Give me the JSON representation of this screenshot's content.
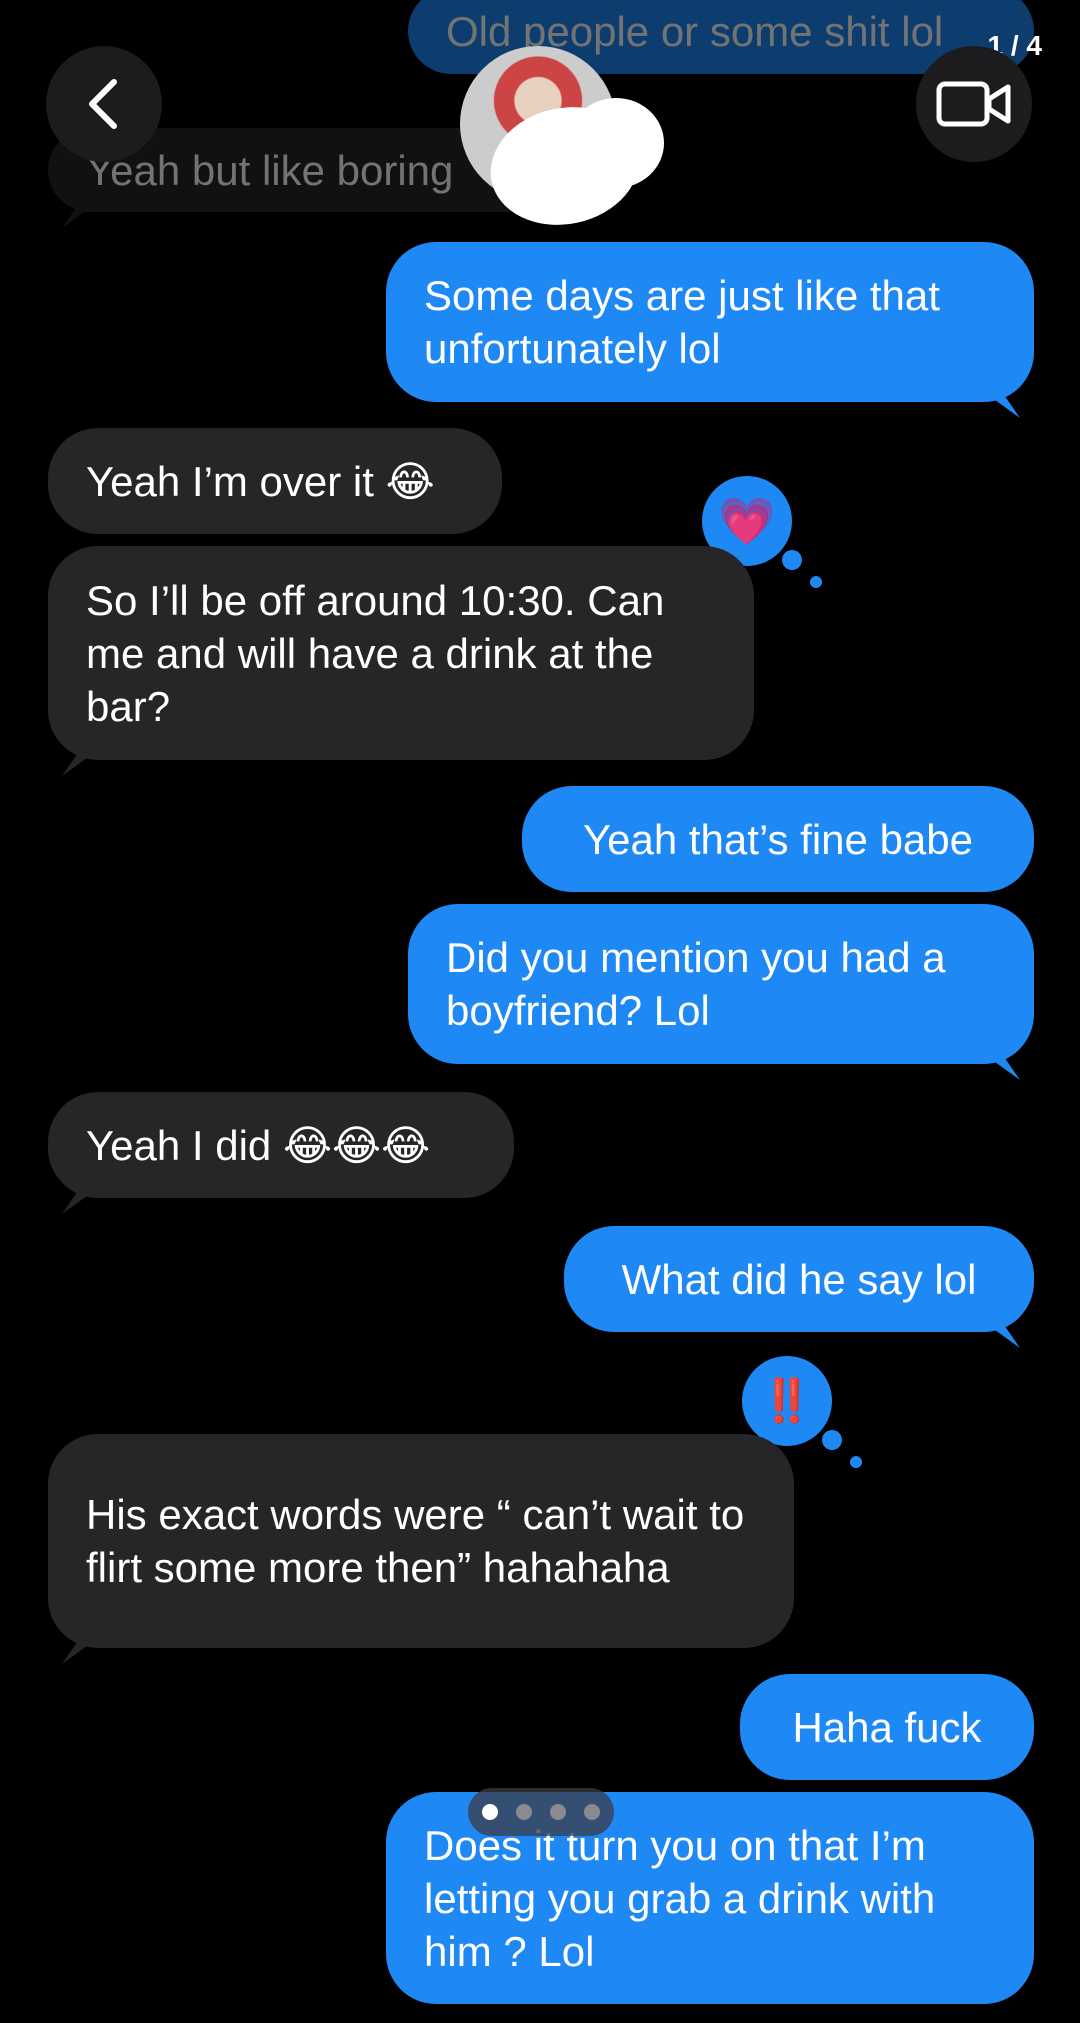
{
  "counter": "1 / 4",
  "messages": [
    {
      "from": "them",
      "dim": true,
      "text": "Yeah but like boring"
    },
    {
      "from": "me",
      "dim": true,
      "text": "Old people or some shit lol"
    },
    {
      "from": "me",
      "text": "Some days are just like that unfortunately lol"
    },
    {
      "from": "them",
      "text": "Yeah I’m over it 😂"
    },
    {
      "from": "them",
      "text": "So I’ll be off around 10:30. Can me and will have a drink at the bar?",
      "reaction": "💗"
    },
    {
      "from": "me",
      "text": "Yeah that’s fine babe"
    },
    {
      "from": "me",
      "text": "Did you mention you had a boyfriend? Lol"
    },
    {
      "from": "them",
      "text": "Yeah I did 😂😂😂"
    },
    {
      "from": "me",
      "text": "What did he say lol"
    },
    {
      "from": "them",
      "text": "His exact words were “ can’t wait to flirt some more then” hahahaha",
      "reaction": "‼️"
    },
    {
      "from": "me",
      "text": "Haha fuck"
    },
    {
      "from": "me",
      "text": "Does it turn you on that I’m letting you grab a drink with him ? Lol"
    }
  ],
  "pager": {
    "total": 4,
    "active": 1
  },
  "colors": {
    "outgoing": "#1e88f5",
    "incoming": "#262628",
    "background": "#000000"
  }
}
